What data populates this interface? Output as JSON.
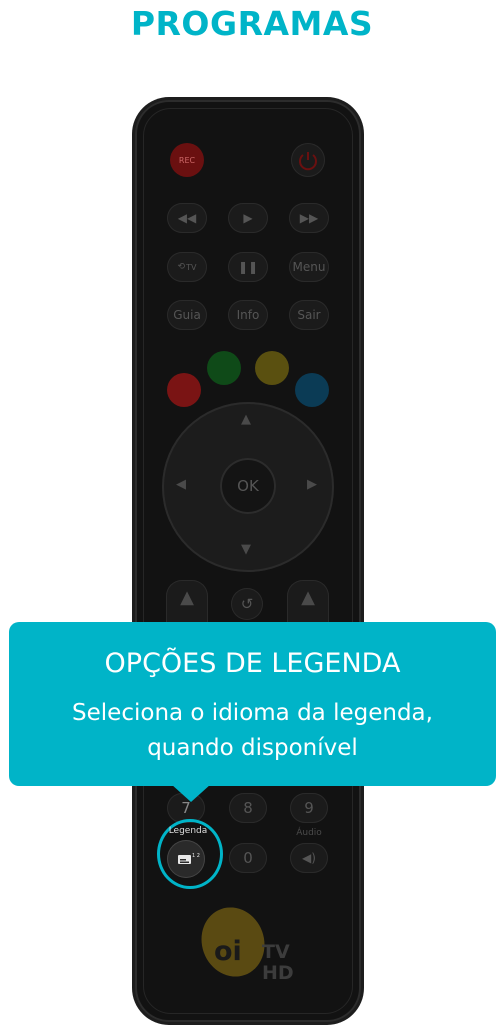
{
  "header": {
    "title": "PROGRAMAS"
  },
  "colors": {
    "accent": "#00b4c8",
    "remote_body": "#121212",
    "red": "#7a1414",
    "green": "#0f4a18",
    "yellow": "#5a5010",
    "blue": "#0b3b55"
  },
  "remote": {
    "rec_label": "REC",
    "guia_label": "Guia",
    "info_label": "Info",
    "sair_label": "Sair",
    "menu_label": "Menu",
    "tv_label": "TV",
    "ok_label": "OK",
    "num_7": "7",
    "num_8": "8",
    "num_9": "9",
    "num_0": "0",
    "audio_label": "Áudio",
    "legenda_label": "Legenda"
  },
  "tooltip": {
    "title": "OPÇÕES DE LEGENDA",
    "line1": "Seleciona o idioma da legenda,",
    "line2": "quando disponível"
  },
  "logo": {
    "brand": "oi",
    "tv": "TV",
    "hd": "HD"
  }
}
